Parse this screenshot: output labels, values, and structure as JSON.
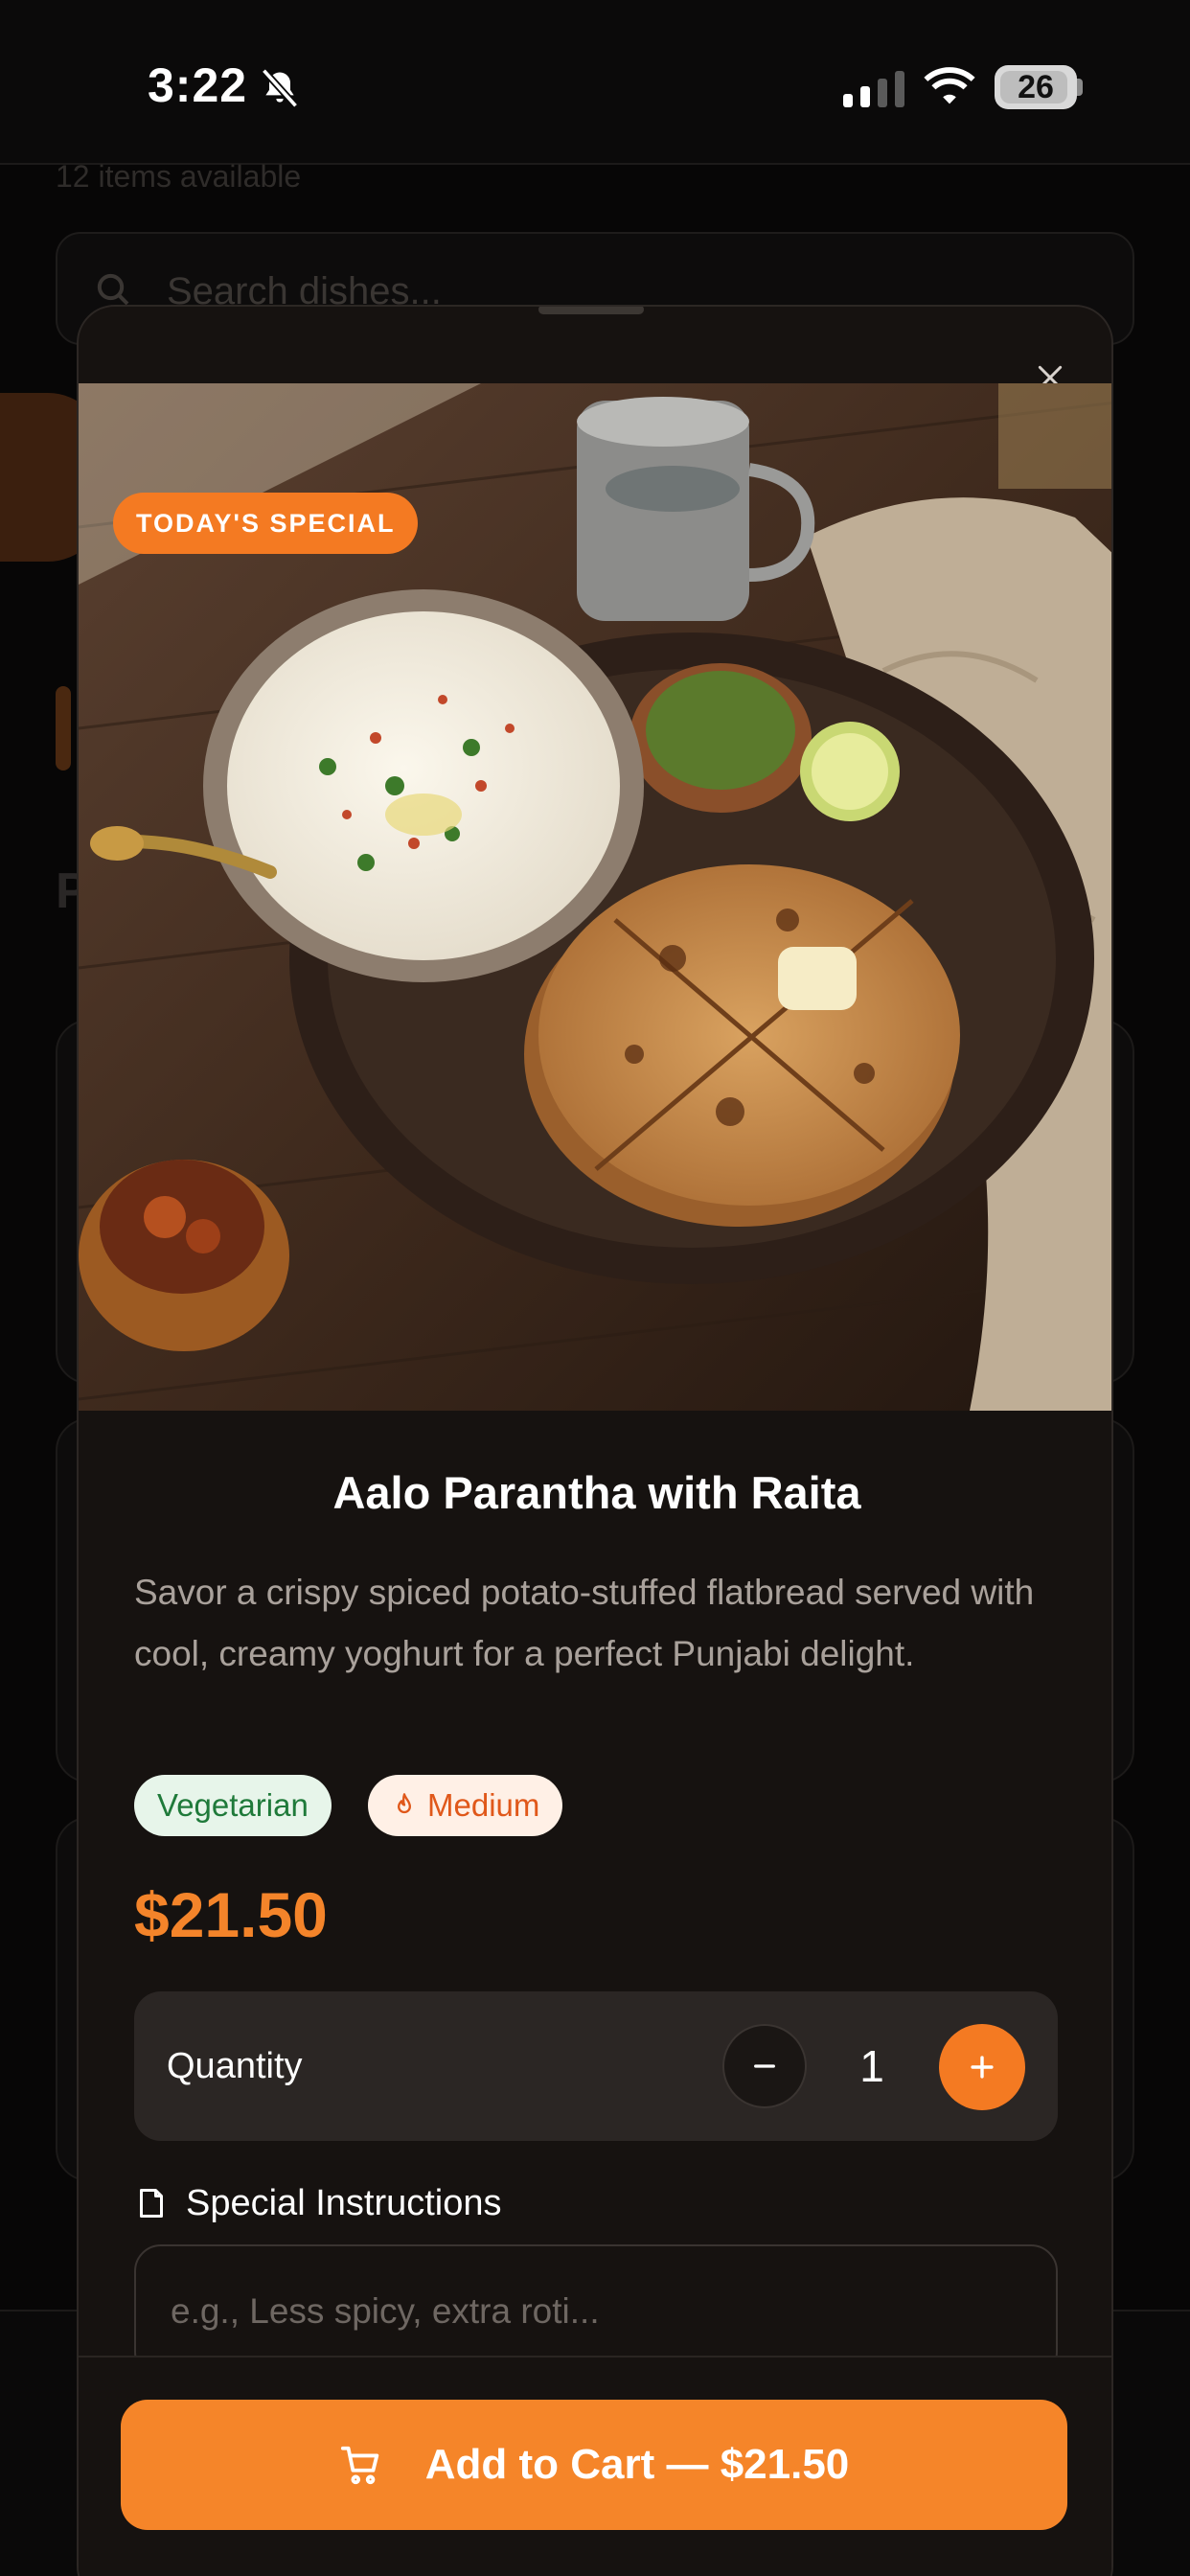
{
  "status_bar": {
    "time": "3:22",
    "battery": "26"
  },
  "background": {
    "items_count": "12 items available",
    "search_placeholder": "Search dishes...",
    "section_letter": "P"
  },
  "modal": {
    "badge": "TODAY'S SPECIAL",
    "title": "Aalo Parantha with Raita",
    "description": "Savor a crispy spiced potato-stuffed flatbread served with cool, creamy yoghurt for a perfect Punjabi delight.",
    "tags": {
      "diet": "Vegetarian",
      "spice": "Medium"
    },
    "price": "$21.50",
    "quantity": {
      "label": "Quantity",
      "value": "1"
    },
    "instructions": {
      "label": "Special Instructions",
      "placeholder": "e.g., Less spicy, extra roti..."
    },
    "cta": "Add to Cart — $21.50"
  },
  "colors": {
    "accent": "#f47a22",
    "background": "#070606",
    "sheet": "#161210",
    "veg_tag_bg": "#e7f5ea",
    "spice_tag_bg": "#fff0e6"
  },
  "icons": [
    "bell-slash-icon",
    "signal-icon",
    "wifi-icon",
    "battery-icon",
    "close-icon",
    "flame-icon",
    "minus-icon",
    "plus-icon",
    "note-icon",
    "cart-icon",
    "search-icon"
  ]
}
